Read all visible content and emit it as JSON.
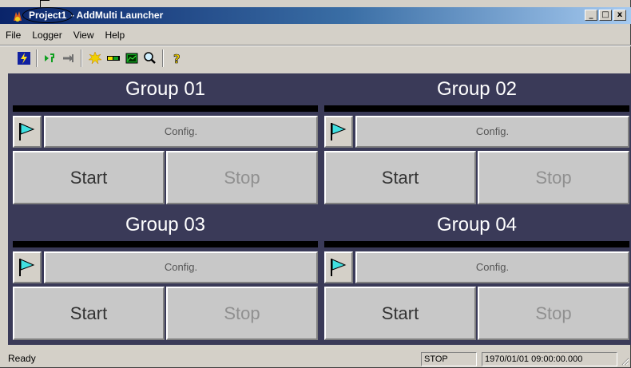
{
  "window": {
    "title_project": "Project1",
    "title_rest": " - AddMulti Launcher",
    "buttons": {
      "minimize": "_",
      "maximize": "□",
      "close": "x"
    }
  },
  "menu": [
    "File",
    "Logger",
    "View",
    "Help"
  ],
  "toolbar": {
    "icons": [
      "lightning-icon",
      "run-icon",
      "arrow-icon",
      "burst-icon",
      "battery-icon",
      "chart-icon",
      "zoom-icon",
      "help-icon"
    ]
  },
  "groups": [
    {
      "title": "Group 01",
      "config": "Config.",
      "start": "Start",
      "stop": "Stop"
    },
    {
      "title": "Group 02",
      "config": "Config.",
      "start": "Start",
      "stop": "Stop"
    },
    {
      "title": "Group 03",
      "config": "Config.",
      "start": "Start",
      "stop": "Stop"
    },
    {
      "title": "Group 04",
      "config": "Config.",
      "start": "Start",
      "stop": "Stop"
    }
  ],
  "status": {
    "left": "Ready",
    "state": "STOP",
    "time": "1970/01/01 09:00:00.000"
  },
  "colors": {
    "group_header_bg": "#3a3a58",
    "title_bar_start": "#0a246a",
    "flag": "#40e0e0"
  }
}
